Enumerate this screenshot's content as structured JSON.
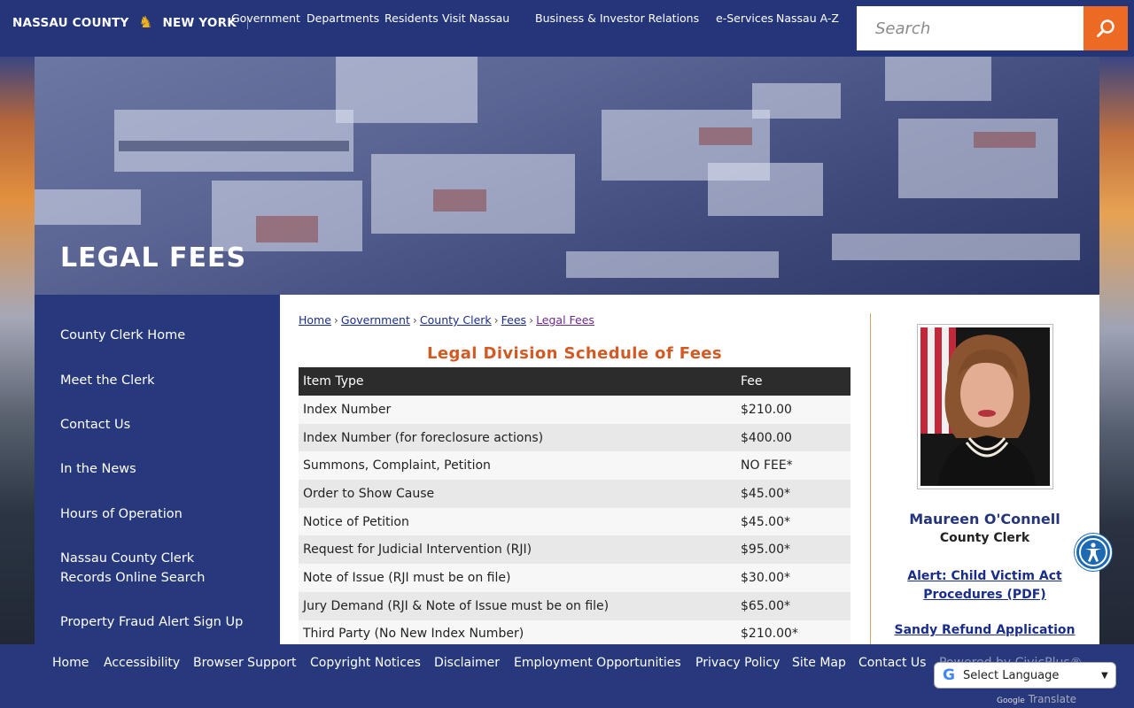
{
  "header": {
    "logo_left": "NASSAU COUNTY",
    "logo_right": "NEW YORK",
    "nav": [
      "Government",
      "Departments",
      "Residents",
      "Visit Nassau",
      "Business & Investor Relations",
      "e-Services",
      "Nassau A-Z"
    ],
    "search_placeholder": "Search"
  },
  "banner": {
    "title": "LEGAL FEES"
  },
  "sidebar": {
    "items": [
      {
        "label": "County Clerk Home"
      },
      {
        "label": "Meet the Clerk"
      },
      {
        "label": "Contact Us"
      },
      {
        "label": "In the News"
      },
      {
        "label": "Hours of Operation"
      },
      {
        "label": "Nassau County Clerk Records Online Search"
      },
      {
        "label": "Property Fraud Alert Sign Up"
      }
    ]
  },
  "breadcrumb": [
    "Home",
    "Government",
    "County Clerk",
    "Fees",
    "Legal Fees"
  ],
  "fees": {
    "title": "Legal Division Schedule of Fees",
    "col_item": "Item Type",
    "col_fee": "Fee",
    "rows": [
      {
        "item": "Index Number",
        "fee": "$210.00"
      },
      {
        "item": "Index Number (for foreclosure actions)",
        "fee": "$400.00"
      },
      {
        "item": "Summons, Complaint, Petition",
        "fee": "NO FEE*"
      },
      {
        "item": "Order to Show Cause",
        "fee": "$45.00*"
      },
      {
        "item": "Notice of Petition",
        "fee": "$45.00*"
      },
      {
        "item": "Request for Judicial Intervention (RJI)",
        "fee": "$95.00*"
      },
      {
        "item": "Note of Issue (RJI must be on file)",
        "fee": "$30.00*"
      },
      {
        "item": "Jury Demand (RJI & Note of Issue must be on file)",
        "fee": "$65.00*"
      },
      {
        "item": "Third Party (No New Index Number)",
        "fee": "$210.00*"
      }
    ]
  },
  "profile": {
    "name": "Maureen O'Connell",
    "role": "County Clerk",
    "alert_link": "Alert: Child Victim Act Procedures (PDF)",
    "sandy_link": "Sandy Refund Application"
  },
  "footer": {
    "links": [
      "Home",
      "Accessibility",
      "Browser Support",
      "Copyright Notices",
      "Disclaimer",
      "Employment Opportunities",
      "Privacy Policy",
      "Site Map",
      "Contact Us"
    ],
    "powered": "Powered by CivicPlus®"
  },
  "translate": {
    "label": "Select Language",
    "powered_by": "Google",
    "powered_word": "Translate"
  },
  "colors": {
    "navy": "#24357a",
    "accent_orange": "#ec6a24",
    "title_orange": "#d35a24",
    "link_blue": "#1a2d8a"
  }
}
